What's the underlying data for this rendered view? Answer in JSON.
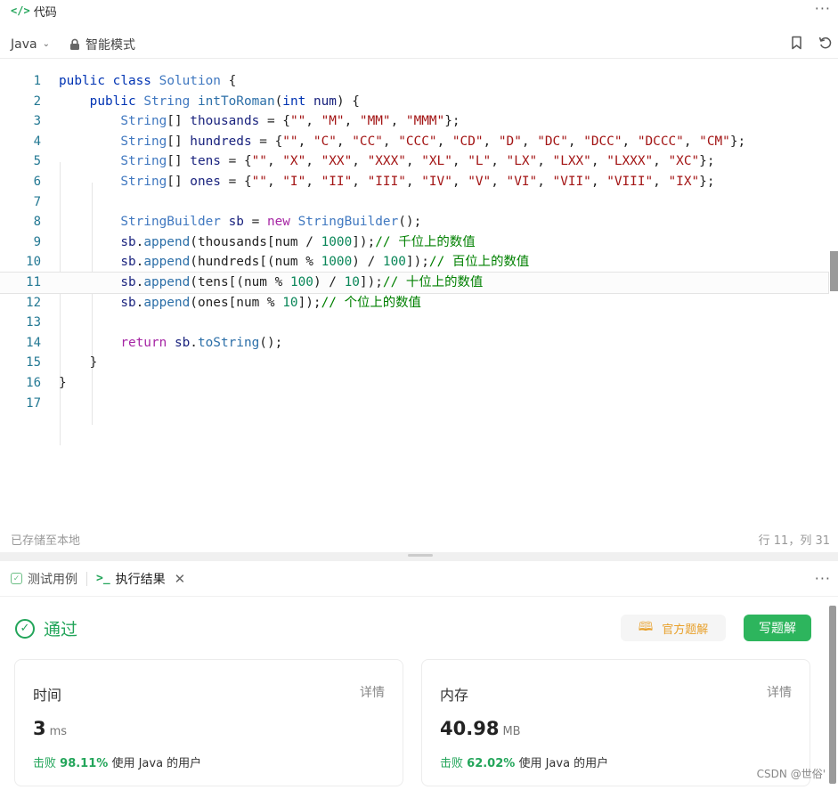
{
  "header": {
    "icon": "code-tag-icon",
    "title": "代码"
  },
  "toolbar": {
    "language": "Java",
    "mode_label": "智能模式"
  },
  "editor": {
    "line_numbers": [
      "1",
      "2",
      "3",
      "4",
      "5",
      "6",
      "7",
      "8",
      "9",
      "10",
      "11",
      "12",
      "13",
      "14",
      "15",
      "16",
      "17"
    ],
    "active_line": 11
  },
  "status": {
    "saved": "已存储至本地",
    "cursor": "行 11，列 31"
  },
  "result": {
    "tabs": [
      {
        "label": "测试用例"
      },
      {
        "label": "执行结果"
      }
    ],
    "verdict": "通过",
    "official_button": "官方题解",
    "write_button": "写题解",
    "time_card": {
      "title": "时间",
      "detail": "详情",
      "value": "3",
      "unit": "ms",
      "beat_prefix": "击败",
      "beat_percent": "98.11%",
      "beat_suffix": "使用 Java 的用户"
    },
    "memory_card": {
      "title": "内存",
      "detail": "详情",
      "value": "40.98",
      "unit": "MB",
      "beat_prefix": "击败",
      "beat_percent": "62.02%",
      "beat_suffix": "使用 Java 的用户"
    }
  },
  "watermark": "CSDN @世俗'",
  "colors": {
    "accent_green": "#23a55a",
    "button_green": "#2db55d",
    "official_orange": "#e8a02a"
  },
  "code_lines": [
    [
      [
        "kw2",
        "public"
      ],
      [
        "pl",
        " "
      ],
      [
        "kw2",
        "class"
      ],
      [
        "pl",
        " "
      ],
      [
        "ty",
        "Solution"
      ],
      [
        "pl",
        " {"
      ]
    ],
    [
      [
        "pl",
        "    "
      ],
      [
        "kw2",
        "public"
      ],
      [
        "pl",
        " "
      ],
      [
        "ty",
        "String"
      ],
      [
        "pl",
        " "
      ],
      [
        "fn",
        "intToRoman"
      ],
      [
        "pl",
        "("
      ],
      [
        "kw2",
        "int"
      ],
      [
        "pl",
        " "
      ],
      [
        "id",
        "num"
      ],
      [
        "pl",
        ") {"
      ]
    ],
    [
      [
        "pl",
        "        "
      ],
      [
        "ty",
        "String"
      ],
      [
        "pl",
        "[] "
      ],
      [
        "id",
        "thousands"
      ],
      [
        "pl",
        " = {"
      ],
      [
        "str",
        "\"\""
      ],
      [
        "pl",
        ", "
      ],
      [
        "str",
        "\"M\""
      ],
      [
        "pl",
        ", "
      ],
      [
        "str",
        "\"MM\""
      ],
      [
        "pl",
        ", "
      ],
      [
        "str",
        "\"MMM\""
      ],
      [
        "pl",
        "};"
      ]
    ],
    [
      [
        "pl",
        "        "
      ],
      [
        "ty",
        "String"
      ],
      [
        "pl",
        "[] "
      ],
      [
        "id",
        "hundreds"
      ],
      [
        "pl",
        " = {"
      ],
      [
        "str",
        "\"\""
      ],
      [
        "pl",
        ", "
      ],
      [
        "str",
        "\"C\""
      ],
      [
        "pl",
        ", "
      ],
      [
        "str",
        "\"CC\""
      ],
      [
        "pl",
        ", "
      ],
      [
        "str",
        "\"CCC\""
      ],
      [
        "pl",
        ", "
      ],
      [
        "str",
        "\"CD\""
      ],
      [
        "pl",
        ", "
      ],
      [
        "str",
        "\"D\""
      ],
      [
        "pl",
        ", "
      ],
      [
        "str",
        "\"DC\""
      ],
      [
        "pl",
        ", "
      ],
      [
        "str",
        "\"DCC\""
      ],
      [
        "pl",
        ", "
      ],
      [
        "str",
        "\"DCCC\""
      ],
      [
        "pl",
        ", "
      ],
      [
        "str",
        "\"CM\""
      ],
      [
        "pl",
        "};"
      ]
    ],
    [
      [
        "pl",
        "        "
      ],
      [
        "ty",
        "String"
      ],
      [
        "pl",
        "[] "
      ],
      [
        "id",
        "tens"
      ],
      [
        "pl",
        " = {"
      ],
      [
        "str",
        "\"\""
      ],
      [
        "pl",
        ", "
      ],
      [
        "str",
        "\"X\""
      ],
      [
        "pl",
        ", "
      ],
      [
        "str",
        "\"XX\""
      ],
      [
        "pl",
        ", "
      ],
      [
        "str",
        "\"XXX\""
      ],
      [
        "pl",
        ", "
      ],
      [
        "str",
        "\"XL\""
      ],
      [
        "pl",
        ", "
      ],
      [
        "str",
        "\"L\""
      ],
      [
        "pl",
        ", "
      ],
      [
        "str",
        "\"LX\""
      ],
      [
        "pl",
        ", "
      ],
      [
        "str",
        "\"LXX\""
      ],
      [
        "pl",
        ", "
      ],
      [
        "str",
        "\"LXXX\""
      ],
      [
        "pl",
        ", "
      ],
      [
        "str",
        "\"XC\""
      ],
      [
        "pl",
        "};"
      ]
    ],
    [
      [
        "pl",
        "        "
      ],
      [
        "ty",
        "String"
      ],
      [
        "pl",
        "[] "
      ],
      [
        "id",
        "ones"
      ],
      [
        "pl",
        " = {"
      ],
      [
        "str",
        "\"\""
      ],
      [
        "pl",
        ", "
      ],
      [
        "str",
        "\"I\""
      ],
      [
        "pl",
        ", "
      ],
      [
        "str",
        "\"II\""
      ],
      [
        "pl",
        ", "
      ],
      [
        "str",
        "\"III\""
      ],
      [
        "pl",
        ", "
      ],
      [
        "str",
        "\"IV\""
      ],
      [
        "pl",
        ", "
      ],
      [
        "str",
        "\"V\""
      ],
      [
        "pl",
        ", "
      ],
      [
        "str",
        "\"VI\""
      ],
      [
        "pl",
        ", "
      ],
      [
        "str",
        "\"VII\""
      ],
      [
        "pl",
        ", "
      ],
      [
        "str",
        "\"VIII\""
      ],
      [
        "pl",
        ", "
      ],
      [
        "str",
        "\"IX\""
      ],
      [
        "pl",
        "};"
      ]
    ],
    [],
    [
      [
        "pl",
        "        "
      ],
      [
        "ty",
        "StringBuilder"
      ],
      [
        "pl",
        " "
      ],
      [
        "id",
        "sb"
      ],
      [
        "pl",
        " = "
      ],
      [
        "kw",
        "new"
      ],
      [
        "pl",
        " "
      ],
      [
        "ty",
        "StringBuilder"
      ],
      [
        "pl",
        "();"
      ]
    ],
    [
      [
        "pl",
        "        "
      ],
      [
        "id",
        "sb"
      ],
      [
        "pl",
        "."
      ],
      [
        "fn",
        "append"
      ],
      [
        "pl",
        "(thousands[num / "
      ],
      [
        "num",
        "1000"
      ],
      [
        "pl",
        "]);"
      ],
      [
        "cm",
        "// 千位上的数值"
      ]
    ],
    [
      [
        "pl",
        "        "
      ],
      [
        "id",
        "sb"
      ],
      [
        "pl",
        "."
      ],
      [
        "fn",
        "append"
      ],
      [
        "pl",
        "(hundreds[(num % "
      ],
      [
        "num",
        "1000"
      ],
      [
        "pl",
        ") / "
      ],
      [
        "num",
        "100"
      ],
      [
        "pl",
        "]);"
      ],
      [
        "cm",
        "// 百位上的数值"
      ]
    ],
    [
      [
        "pl",
        "        "
      ],
      [
        "id",
        "sb"
      ],
      [
        "pl",
        "."
      ],
      [
        "fn",
        "append"
      ],
      [
        "pl",
        "(tens[(num % "
      ],
      [
        "num",
        "100"
      ],
      [
        "pl",
        ") / "
      ],
      [
        "num",
        "10"
      ],
      [
        "pl",
        "]);"
      ],
      [
        "cm",
        "// 十位上的数值"
      ]
    ],
    [
      [
        "pl",
        "        "
      ],
      [
        "id",
        "sb"
      ],
      [
        "pl",
        "."
      ],
      [
        "fn",
        "append"
      ],
      [
        "pl",
        "(ones[num % "
      ],
      [
        "num",
        "10"
      ],
      [
        "pl",
        "]);"
      ],
      [
        "cm",
        "// 个位上的数值"
      ]
    ],
    [],
    [
      [
        "pl",
        "        "
      ],
      [
        "kw",
        "return"
      ],
      [
        "pl",
        " "
      ],
      [
        "id",
        "sb"
      ],
      [
        "pl",
        "."
      ],
      [
        "fn",
        "toString"
      ],
      [
        "pl",
        "();"
      ]
    ],
    [
      [
        "pl",
        "    }"
      ]
    ],
    [
      [
        "pl",
        "}"
      ]
    ],
    []
  ]
}
